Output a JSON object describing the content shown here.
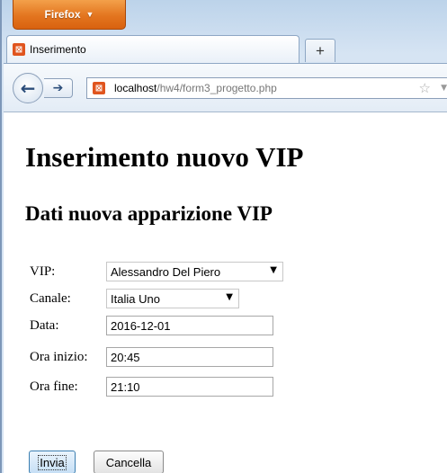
{
  "browser": {
    "menu_button": "Firefox",
    "tab_title": "Inserimento",
    "newtab_glyph": "+",
    "url_host": "localhost",
    "url_path": "/hw4/form3_progetto.php"
  },
  "page": {
    "heading": "Inserimento nuovo VIP",
    "subheading": "Dati nuova apparizione VIP"
  },
  "form": {
    "vip": {
      "label": "VIP:",
      "value": "Alessandro Del Piero"
    },
    "canale": {
      "label": "Canale:",
      "value": "Italia Uno"
    },
    "data": {
      "label": "Data:",
      "value": "2016-12-01"
    },
    "ora_inizio": {
      "label": "Ora inizio:",
      "value": "20:45"
    },
    "ora_fine": {
      "label": "Ora fine:",
      "value": "21:10"
    },
    "submit_label": "Invia",
    "reset_label": "Cancella"
  },
  "icons": {
    "favicon": "page-icon",
    "back": "back-arrow-icon",
    "forward": "forward-arrow-icon",
    "bookmark": "star-icon"
  },
  "colors": {
    "firefox_orange": "#e3751f",
    "frame_blue": "#c3d8ee",
    "primary_button_border": "#3c7fb1"
  }
}
